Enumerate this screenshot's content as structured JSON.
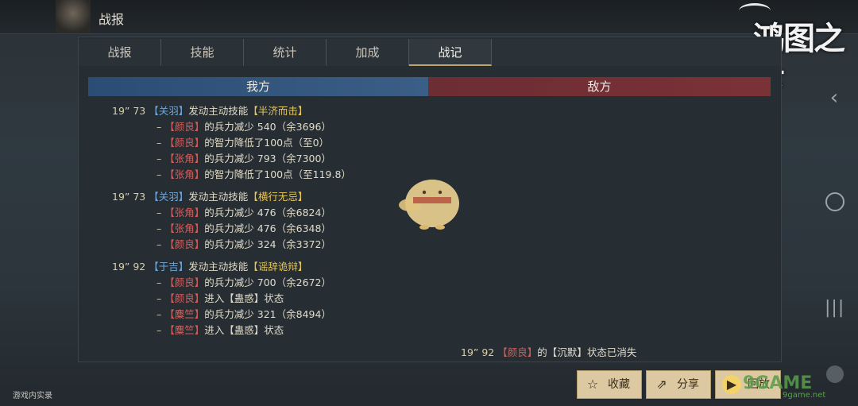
{
  "window": {
    "title": "战报"
  },
  "logo": {
    "text": "鸿图之下"
  },
  "tabs": [
    {
      "label": "战报"
    },
    {
      "label": "技能"
    },
    {
      "label": "统计"
    },
    {
      "label": "加成"
    },
    {
      "label": "战记",
      "active": true
    }
  ],
  "sides": {
    "ours": "我方",
    "enemy": "敌方"
  },
  "log": {
    "events": [
      {
        "time": "19” 73",
        "actor": "关羽",
        "action": "发动主动技能",
        "skill": "半济而击",
        "effects": [
          {
            "target": "颜良",
            "text": "的兵力减少 540（余3696）"
          },
          {
            "target": "颜良",
            "text": "的智力降低了100点（至0）"
          },
          {
            "target": "张角",
            "text": "的兵力减少 793（余7300）"
          },
          {
            "target": "张角",
            "text": "的智力降低了100点（至119.8）"
          }
        ]
      },
      {
        "time": "19” 73",
        "actor": "关羽",
        "action": "发动主动技能",
        "skill": "横行无忌",
        "effects": [
          {
            "target": "张角",
            "text": "的兵力减少 476（余6824）"
          },
          {
            "target": "张角",
            "text": "的兵力减少 476（余6348）"
          },
          {
            "target": "颜良",
            "text": "的兵力减少 324（余3372）"
          }
        ]
      },
      {
        "time": "19” 92",
        "actor": "于吉",
        "action": "发动主动技能",
        "skill": "谣辞诡辩",
        "effects": [
          {
            "target": "颜良",
            "text": "的兵力减少 700（余2672）"
          },
          {
            "target": "颜良",
            "text": "进入【蛊惑】状态"
          },
          {
            "target": "麋竺",
            "text": "的兵力减少 321（余8494）"
          },
          {
            "target": "麋竺",
            "text": "进入【蛊惑】状态"
          }
        ]
      }
    ],
    "enemy_event": {
      "time": "19” 92",
      "target": "颜良",
      "middle": "的【",
      "status": "沉默",
      "tail": "】状态已消失"
    }
  },
  "buttons": {
    "favorite": "收藏",
    "share": "分享",
    "replay": "回放"
  },
  "nav": {
    "back": "‹",
    "menu": "|||"
  },
  "footer": {
    "note": "游戏内实录"
  },
  "watermark": {
    "main": "9GAME",
    "sub": "9game.net"
  },
  "colors": {
    "ours_header": "#3b5e86",
    "enemy_header": "#7b3236",
    "accent_button": "#dcc9a2"
  }
}
